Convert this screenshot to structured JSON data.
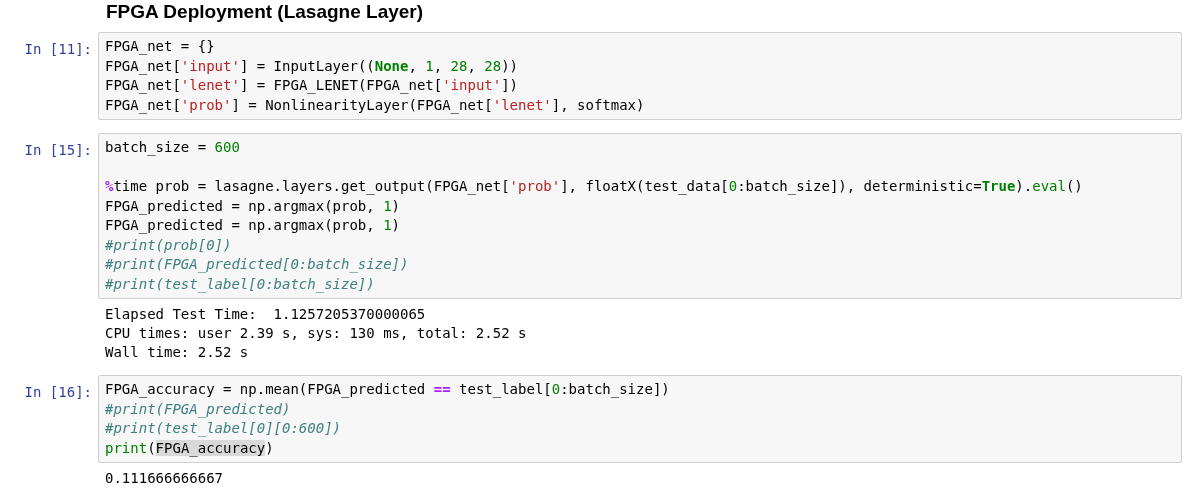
{
  "heading": "FPGA Deployment (Lasagne Layer)",
  "cells": [
    {
      "prompt": "In [11]:",
      "lines": [
        {
          "tokens": [
            {
              "text": "FPGA_net = {}",
              "kind": "plain"
            }
          ]
        },
        {
          "tokens": [
            {
              "text": "FPGA_net[",
              "kind": "plain"
            },
            {
              "text": "'input'",
              "kind": "str"
            },
            {
              "text": "] = InputLayer((",
              "kind": "plain"
            },
            {
              "text": "None",
              "kind": "kw"
            },
            {
              "text": ", ",
              "kind": "plain"
            },
            {
              "text": "1",
              "kind": "num"
            },
            {
              "text": ", ",
              "kind": "plain"
            },
            {
              "text": "28",
              "kind": "num"
            },
            {
              "text": ", ",
              "kind": "plain"
            },
            {
              "text": "28",
              "kind": "num"
            },
            {
              "text": "))",
              "kind": "plain"
            }
          ]
        },
        {
          "tokens": [
            {
              "text": "FPGA_net[",
              "kind": "plain"
            },
            {
              "text": "'lenet'",
              "kind": "str"
            },
            {
              "text": "] = FPGA_LENET(FPGA_net[",
              "kind": "plain"
            },
            {
              "text": "'input'",
              "kind": "str"
            },
            {
              "text": "])",
              "kind": "plain"
            }
          ]
        },
        {
          "tokens": [
            {
              "text": "FPGA_net[",
              "kind": "plain"
            },
            {
              "text": "'prob'",
              "kind": "str"
            },
            {
              "text": "] = NonlinearityLayer(FPGA_net[",
              "kind": "plain"
            },
            {
              "text": "'lenet'",
              "kind": "str"
            },
            {
              "text": "], softmax)",
              "kind": "plain"
            }
          ]
        }
      ]
    },
    {
      "prompt": "In [15]:",
      "lines": [
        {
          "tokens": [
            {
              "text": "batch_size = ",
              "kind": "plain"
            },
            {
              "text": "600",
              "kind": "num"
            }
          ]
        },
        {
          "kind": "blank"
        },
        {
          "tokens": [
            {
              "text": "%",
              "kind": "op"
            },
            {
              "text": "time prob = lasagne.layers.get_output(FPGA_net[",
              "kind": "plain"
            },
            {
              "text": "'prob'",
              "kind": "str"
            },
            {
              "text": "], floatX(test_data[",
              "kind": "plain"
            },
            {
              "text": "0",
              "kind": "num"
            },
            {
              "text": ":batch_size]), deterministic=",
              "kind": "plain"
            },
            {
              "text": "True",
              "kind": "kw"
            },
            {
              "text": ").",
              "kind": "plain"
            },
            {
              "text": "eval",
              "kind": "builtin"
            },
            {
              "text": "()",
              "kind": "plain"
            }
          ]
        },
        {
          "tokens": [
            {
              "text": "FPGA_predicted = np.argmax(prob, ",
              "kind": "plain"
            },
            {
              "text": "1",
              "kind": "num"
            },
            {
              "text": ")",
              "kind": "plain"
            }
          ]
        },
        {
          "tokens": [
            {
              "text": "FPGA_predicted = np.argmax(prob, ",
              "kind": "plain"
            },
            {
              "text": "1",
              "kind": "num"
            },
            {
              "text": ")",
              "kind": "plain"
            }
          ]
        },
        {
          "tokens": [
            {
              "text": "#print(prob[0])",
              "kind": "comment"
            }
          ]
        },
        {
          "tokens": [
            {
              "text": "#print(FPGA_predicted[0:batch_size])",
              "kind": "comment"
            }
          ]
        },
        {
          "tokens": [
            {
              "text": "#print(test_label[0:batch_size])",
              "kind": "comment"
            }
          ]
        }
      ],
      "output": [
        "Elapsed Test Time:  1.1257205370000065",
        "CPU times: user 2.39 s, sys: 130 ms, total: 2.52 s",
        "Wall time: 2.52 s"
      ]
    },
    {
      "prompt": "In [16]:",
      "lines": [
        {
          "tokens": [
            {
              "text": "FPGA_accuracy = np.mean(FPGA_predicted ",
              "kind": "plain"
            },
            {
              "text": "==",
              "kind": "op"
            },
            {
              "text": " test_label[",
              "kind": "plain"
            },
            {
              "text": "0",
              "kind": "num"
            },
            {
              "text": ":batch_size])",
              "kind": "plain"
            }
          ]
        },
        {
          "tokens": [
            {
              "text": "#print(FPGA_predicted)",
              "kind": "comment"
            }
          ]
        },
        {
          "tokens": [
            {
              "text": "#print(test_label[0][0:600])",
              "kind": "comment"
            }
          ]
        },
        {
          "tokens": [
            {
              "text": "print",
              "kind": "builtin"
            },
            {
              "text": "(",
              "kind": "plain"
            },
            {
              "text": "FPGA_accuracy",
              "kind": "match"
            },
            {
              "text": ")",
              "kind": "plain"
            }
          ]
        }
      ],
      "output": [
        "0.111666666667"
      ]
    }
  ]
}
